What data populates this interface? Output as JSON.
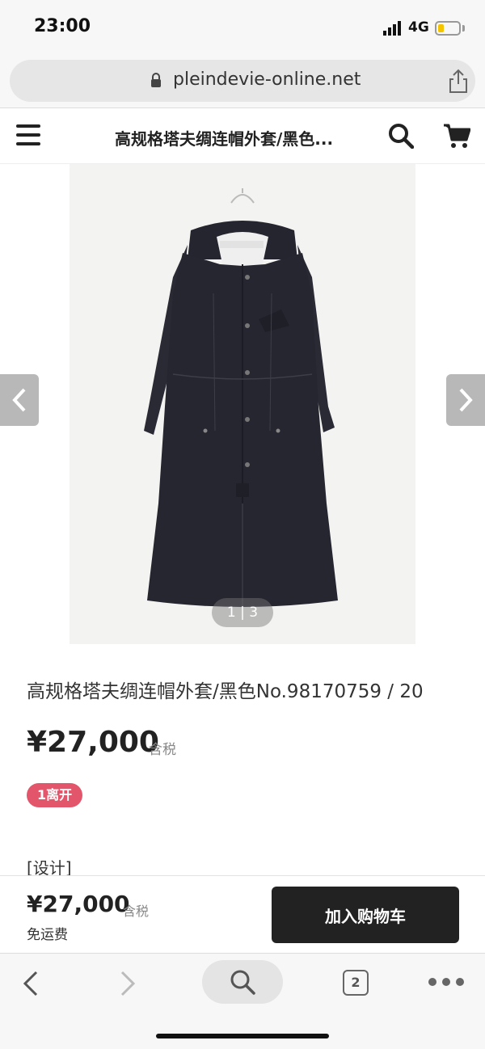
{
  "status": {
    "time": "23:00",
    "network": "4G"
  },
  "browser": {
    "url": "pleindevie-online.net",
    "tab_count": "2"
  },
  "header": {
    "title": "高规格塔夫绸连帽外套/黑色..."
  },
  "gallery": {
    "counter": "1 | 3"
  },
  "product": {
    "title": "高规格塔夫绸连帽外套/黑色No.98170759 / 20",
    "price": "¥27,000",
    "tax_label": "含税",
    "badge": "1离开",
    "section_label": "[设计]"
  },
  "buy_bar": {
    "price": "¥27,000",
    "tax_label": "含税",
    "shipping": "免运费",
    "add_to_cart": "加入购物车"
  },
  "colors": {
    "badge": "#e2556a",
    "button": "#222222",
    "battery": "#f5c400"
  },
  "icons": [
    "signal-icon",
    "battery-icon",
    "lock-icon",
    "share-icon",
    "menu-icon",
    "search-icon",
    "cart-icon",
    "chevron-left-icon",
    "chevron-right-icon",
    "back-icon",
    "forward-icon",
    "tabs-icon",
    "more-icon"
  ]
}
